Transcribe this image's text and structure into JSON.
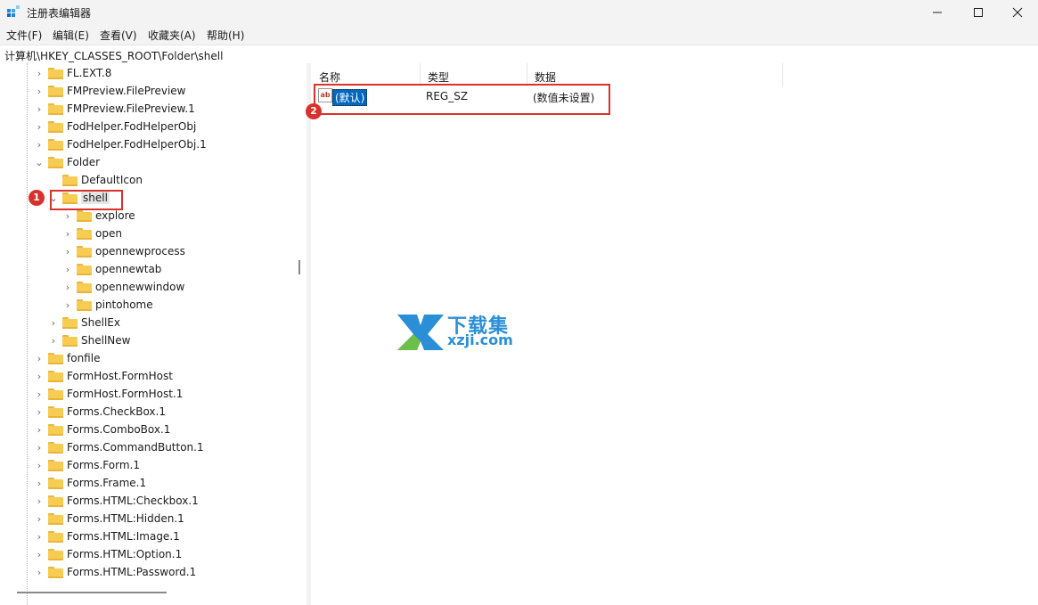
{
  "window": {
    "title": "注册表编辑器"
  },
  "menu": [
    "文件(F)",
    "编辑(E)",
    "查看(V)",
    "收藏夹(A)",
    "帮助(H)"
  ],
  "address": "计算机\\HKEY_CLASSES_ROOT\\Folder\\shell",
  "tree": [
    {
      "label": "FL.EXT.8",
      "chev": "›"
    },
    {
      "label": "FMPreview.FilePreview",
      "chev": "›"
    },
    {
      "label": "FMPreview.FilePreview.1",
      "chev": "›"
    },
    {
      "label": "FodHelper.FodHelperObj",
      "chev": "›"
    },
    {
      "label": "FodHelper.FodHelperObj.1",
      "chev": "›"
    },
    {
      "label": "Folder",
      "chev": "⌄"
    },
    {
      "label": "DefaultIcon",
      "chev": ""
    },
    {
      "label": "shell",
      "chev": "⌄"
    },
    {
      "label": "explore",
      "chev": "›"
    },
    {
      "label": "open",
      "chev": "›"
    },
    {
      "label": "opennewprocess",
      "chev": "›"
    },
    {
      "label": "opennewtab",
      "chev": "›"
    },
    {
      "label": "opennewwindow",
      "chev": "›"
    },
    {
      "label": "pintohome",
      "chev": "›"
    },
    {
      "label": "ShellEx",
      "chev": "›"
    },
    {
      "label": "ShellNew",
      "chev": "›"
    },
    {
      "label": "fonfile",
      "chev": "›"
    },
    {
      "label": "FormHost.FormHost",
      "chev": "›"
    },
    {
      "label": "FormHost.FormHost.1",
      "chev": "›"
    },
    {
      "label": "Forms.CheckBox.1",
      "chev": "›"
    },
    {
      "label": "Forms.ComboBox.1",
      "chev": "›"
    },
    {
      "label": "Forms.CommandButton.1",
      "chev": "›"
    },
    {
      "label": "Forms.Form.1",
      "chev": "›"
    },
    {
      "label": "Forms.Frame.1",
      "chev": "›"
    },
    {
      "label": "Forms.HTML:Checkbox.1",
      "chev": "›"
    },
    {
      "label": "Forms.HTML:Hidden.1",
      "chev": "›"
    },
    {
      "label": "Forms.HTML:Image.1",
      "chev": "›"
    },
    {
      "label": "Forms.HTML:Option.1",
      "chev": "›"
    },
    {
      "label": "Forms.HTML:Password.1",
      "chev": "›"
    }
  ],
  "columns": {
    "name": "名称",
    "type": "类型",
    "data": "数据"
  },
  "value": {
    "name": "(默认)",
    "type": "REG_SZ",
    "data": "(数值未设置)",
    "icon": "ab"
  },
  "badges": {
    "first": "1",
    "second": "2"
  },
  "watermark": {
    "cn": "下载集",
    "url": "xzji.com"
  },
  "colors": {
    "highlight": "#d9322c",
    "selection": "#0067c0",
    "folder": "#f7cc53",
    "watermark": "#2a8fd6"
  }
}
